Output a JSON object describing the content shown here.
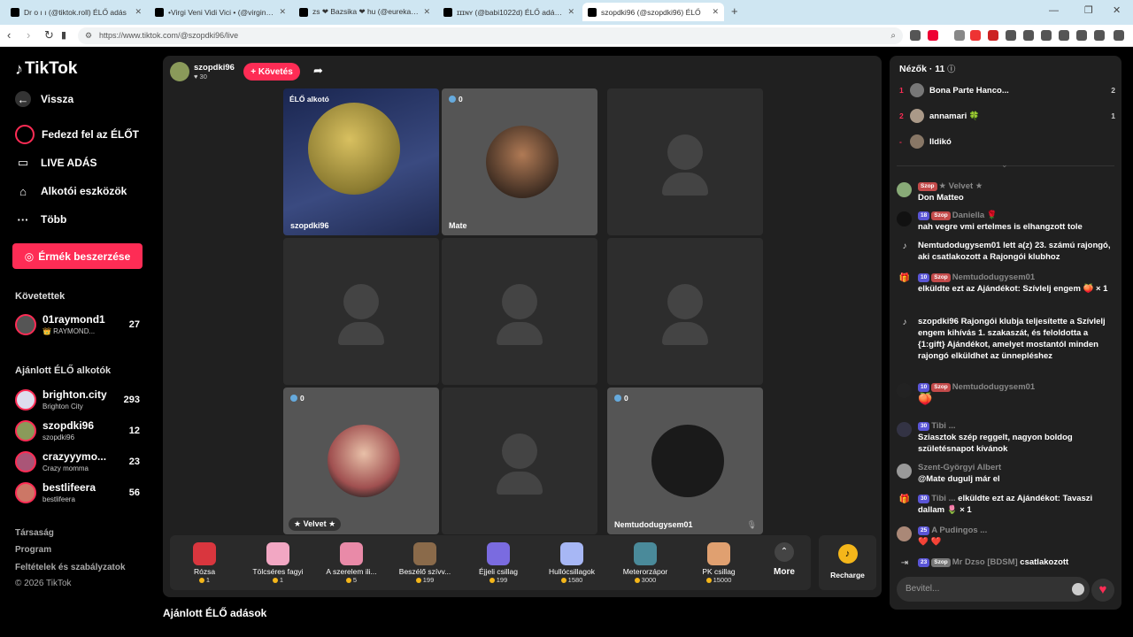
{
  "browser": {
    "tabs": [
      {
        "label": "Dr o ı ı (@tiktok.roll) ÉLŐ adás"
      },
      {
        "label": "•Virgi Veni Vidi Vici • (@virginvenividi)"
      },
      {
        "label": "zs ❤ Bazsika ❤ hu (@eurekaeureka)"
      },
      {
        "label": "ɪɪɪɴʏ (@babi1022d) ÉLŐ adásban"
      },
      {
        "label": "szopdki96 (@szopdki96) ÉLŐ"
      }
    ],
    "new_tab": "+",
    "url": "https://www.tiktok.com/@szopdki96/live"
  },
  "sidebar": {
    "logo": "TikTok",
    "back": "Vissza",
    "nav": [
      {
        "label": "Fedezd fel az ÉLŐT"
      },
      {
        "label": "LIVE ADÁS"
      },
      {
        "label": "Alkotói eszközök"
      },
      {
        "label": "Több"
      }
    ],
    "coins_button": "Érmék beszerzése",
    "following_title": "Követettek",
    "following": [
      {
        "name": "01raymond1",
        "sub": "👑 RAYMOND...",
        "count": "27"
      }
    ],
    "recommended_title": "Ajánlott ÉLŐ alkotók",
    "recommended": [
      {
        "name": "brighton.city",
        "sub": "Brighton City",
        "count": "293"
      },
      {
        "name": "szopdki96",
        "sub": "szopdki96",
        "count": "12"
      },
      {
        "name": "crazyyymo...",
        "sub": "Crazy momma",
        "count": "23"
      },
      {
        "name": "bestlifeera",
        "sub": "bestlifeera",
        "count": "56"
      }
    ],
    "footer": [
      "Társaság",
      "Program",
      "Feltételek és szabályzatok",
      "© 2026 TikTok"
    ]
  },
  "stage": {
    "host_name": "szopdki96",
    "host_likes": "♥ 30",
    "follow_button": "+ Követés",
    "cells": {
      "host_label": "ÉLŐ alkotó",
      "host_name": "szopdki96",
      "c2_count": "0",
      "c2_name": "Mate",
      "c7_count": "0",
      "c7_name": "★ Velvet ★",
      "c9_count": "0",
      "c9_name": "Nemtudodugysem01"
    },
    "gifts": [
      {
        "name": "Rózsa",
        "price": "1",
        "color": "#d9363e"
      },
      {
        "name": "Tölcséres fagyi",
        "price": "1",
        "color": "#f2a7c3"
      },
      {
        "name": "A szerelem ili...",
        "price": "5",
        "color": "#e98aa8"
      },
      {
        "name": "Beszélő szívv...",
        "price": "199",
        "color": "#8a6a4a"
      },
      {
        "name": "Éjjeli csillag",
        "price": "199",
        "color": "#7a6be0"
      },
      {
        "name": "Hullócsillagok",
        "price": "1580",
        "color": "#a7b7f5"
      },
      {
        "name": "Meterorzápor",
        "price": "3000",
        "color": "#4a8a9a"
      },
      {
        "name": "PK csillag",
        "price": "15000",
        "color": "#e0a070"
      }
    ],
    "more": "More",
    "recharge": "Recharge",
    "below_title": "Ajánlott ÉLŐ adások"
  },
  "chat": {
    "viewers_title": "Nézők · 11",
    "viewers": [
      {
        "rank": "1",
        "name": "Bona Parte Hanco...",
        "score": "2"
      },
      {
        "rank": "2",
        "name": "annamari 🍀",
        "score": "1"
      },
      {
        "rank": "-",
        "name": "Ildikó",
        "score": ""
      }
    ],
    "messages": [
      {
        "user": "★ Velvet ★",
        "text": "Don Matteo"
      },
      {
        "user": "Daniella 🌹",
        "text": "nah vegre vmi ertelmes is elhangzott tole"
      },
      {
        "user": "",
        "text": "Nemtudodugysem01 lett a(z) 23. számú rajongó, aki csatlakozott a Rajongói klubhoz"
      },
      {
        "user": "Nemtudodugysem01",
        "text": "elküldte ezt az Ajándékot: Szívlelj engem 🍑 × 1"
      },
      {
        "user": "",
        "text": "szopdki96 Rajongói klubja teljesítette a Szívlelj engem kihívás 1. szakaszát, és feloldotta a {1:gift} Ajándékot, amelyet mostantól minden rajongó elküldhet az ünnepléshez"
      },
      {
        "user": "Nemtudodugysem01",
        "text": "🍑"
      },
      {
        "user": "Tibi ...",
        "text": "Sziasztok szép reggelt, nagyon boldog születésnapot kívánok"
      },
      {
        "user": "Szent-Györgyi Albert",
        "text": "@Mate dugulj már el"
      },
      {
        "user": "Tibi ...",
        "text": "elküldte ezt az Ajándékot: Tavaszi dallam 🌷 × 1"
      },
      {
        "user": "A Pudingos ...",
        "text": "❤️ ❤️"
      },
      {
        "user": "Mr Dzso [BDSM]",
        "text": "csatlakozott"
      }
    ],
    "badges": {
      "l18": "18",
      "l10": "10",
      "l30": "30",
      "l25": "25",
      "l23": "23",
      "szop": "Szop"
    },
    "input_placeholder": "Bevitel..."
  }
}
